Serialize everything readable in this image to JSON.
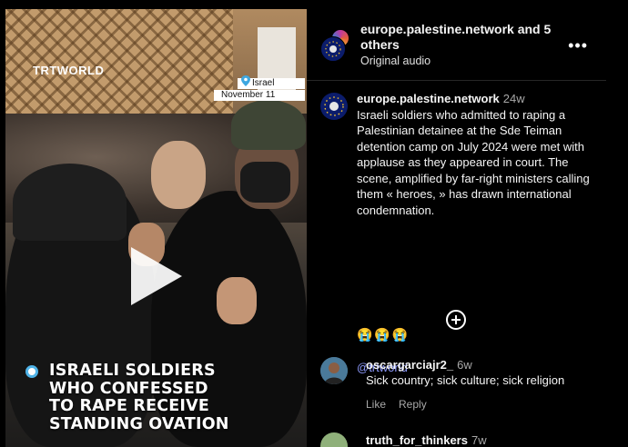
{
  "video": {
    "logo": "TRTWORLD",
    "location": "Israel",
    "date": "November 11",
    "headline_lines": [
      "ISRAELI SOLDIERS",
      "WHO CONFESSED",
      "TO RAPE RECEIVE",
      "STANDING OVATION"
    ],
    "play_icon": "play-icon"
  },
  "header": {
    "title": "europe.palestine.network and 5 others",
    "subtitle": "Original audio",
    "more_icon": "more-options-icon"
  },
  "caption": {
    "username": "europe.palestine.network",
    "time": "24w",
    "text": "Israeli soldiers who admitted to raping a Palestinian detainee at the Sde Teiman detention camp on July 2024 were met with applause as they appeared in court. The scene, amplified by far-right ministers calling them « heroes, » has drawn international condemnation.",
    "emojis": "😭😭😭",
    "mention": "@trtworld"
  },
  "load_more_icon": "plus-circle-icon",
  "comments": [
    {
      "username": "oscargarciajr2_",
      "time": "6w",
      "text": "Sick country; sick culture; sick religion",
      "like_label": "Like",
      "reply_label": "Reply"
    },
    {
      "username": "truth_for_thinkers",
      "time": "7w"
    }
  ],
  "colors": {
    "background": "#000000",
    "link": "#8e9bff",
    "muted": "#a8a8a8",
    "headline_accent": "#4fb3e8"
  }
}
